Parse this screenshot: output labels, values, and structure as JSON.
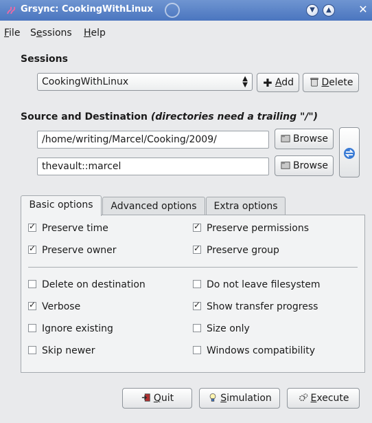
{
  "window": {
    "title": "Grsync: CookingWithLinux",
    "controls": [
      "minimize",
      "maximize",
      "close"
    ]
  },
  "menubar": [
    {
      "label": "File",
      "mnemonic": "F",
      "rest": "ile"
    },
    {
      "label": "Sessions",
      "mnemonic": "e",
      "pre": "S",
      "rest": "ssions"
    },
    {
      "label": "Help",
      "mnemonic": "H",
      "rest": "elp"
    }
  ],
  "sessions": {
    "label": "Sessions",
    "selected": "CookingWithLinux",
    "add_pre": "",
    "add_mn": "A",
    "add_rest": "dd",
    "delete_mn": "D",
    "delete_rest": "elete"
  },
  "source_dest": {
    "label": "Source and Destination",
    "hint": "(directories need a trailing \"/\")",
    "source": "/home/writing/Marcel/Cooking/2009/",
    "destination": "thevault::marcel",
    "browse_label": "Browse"
  },
  "tabs": [
    "Basic options",
    "Advanced options",
    "Extra options"
  ],
  "options": {
    "preserve_time": {
      "label": "Preserve time",
      "checked": true
    },
    "preserve_permissions": {
      "label": "Preserve permissions",
      "checked": true
    },
    "preserve_owner": {
      "label": "Preserve owner",
      "checked": true
    },
    "preserve_group": {
      "label": "Preserve group",
      "checked": true
    },
    "delete_on_destination": {
      "label": "Delete on destination",
      "checked": false
    },
    "do_not_leave_filesystem": {
      "label": "Do not leave filesystem",
      "checked": false
    },
    "verbose": {
      "label": "Verbose",
      "checked": true
    },
    "show_transfer_progress": {
      "label": "Show transfer progress",
      "checked": true
    },
    "ignore_existing": {
      "label": "Ignore existing",
      "checked": false
    },
    "size_only": {
      "label": "Size only",
      "checked": false
    },
    "skip_newer": {
      "label": "Skip newer",
      "checked": false
    },
    "windows_compatibility": {
      "label": "Windows compatibility",
      "checked": false
    }
  },
  "actions": {
    "quit_mn": "Q",
    "quit_rest": "uit",
    "simulation_mn": "S",
    "simulation_rest": "imulation",
    "execute_mn": "E",
    "execute_rest": "xecute"
  },
  "icons": {
    "app": "grsync-icon",
    "add": "plus-icon",
    "delete": "trash-icon",
    "browse": "folder-icon",
    "swap": "swap-arrows-icon",
    "quit": "exit-icon",
    "simulation": "lightbulb-icon",
    "execute": "gears-icon"
  },
  "colors": {
    "titlebar": "#5a82c8",
    "swap_icon": "#3a7bd5"
  }
}
